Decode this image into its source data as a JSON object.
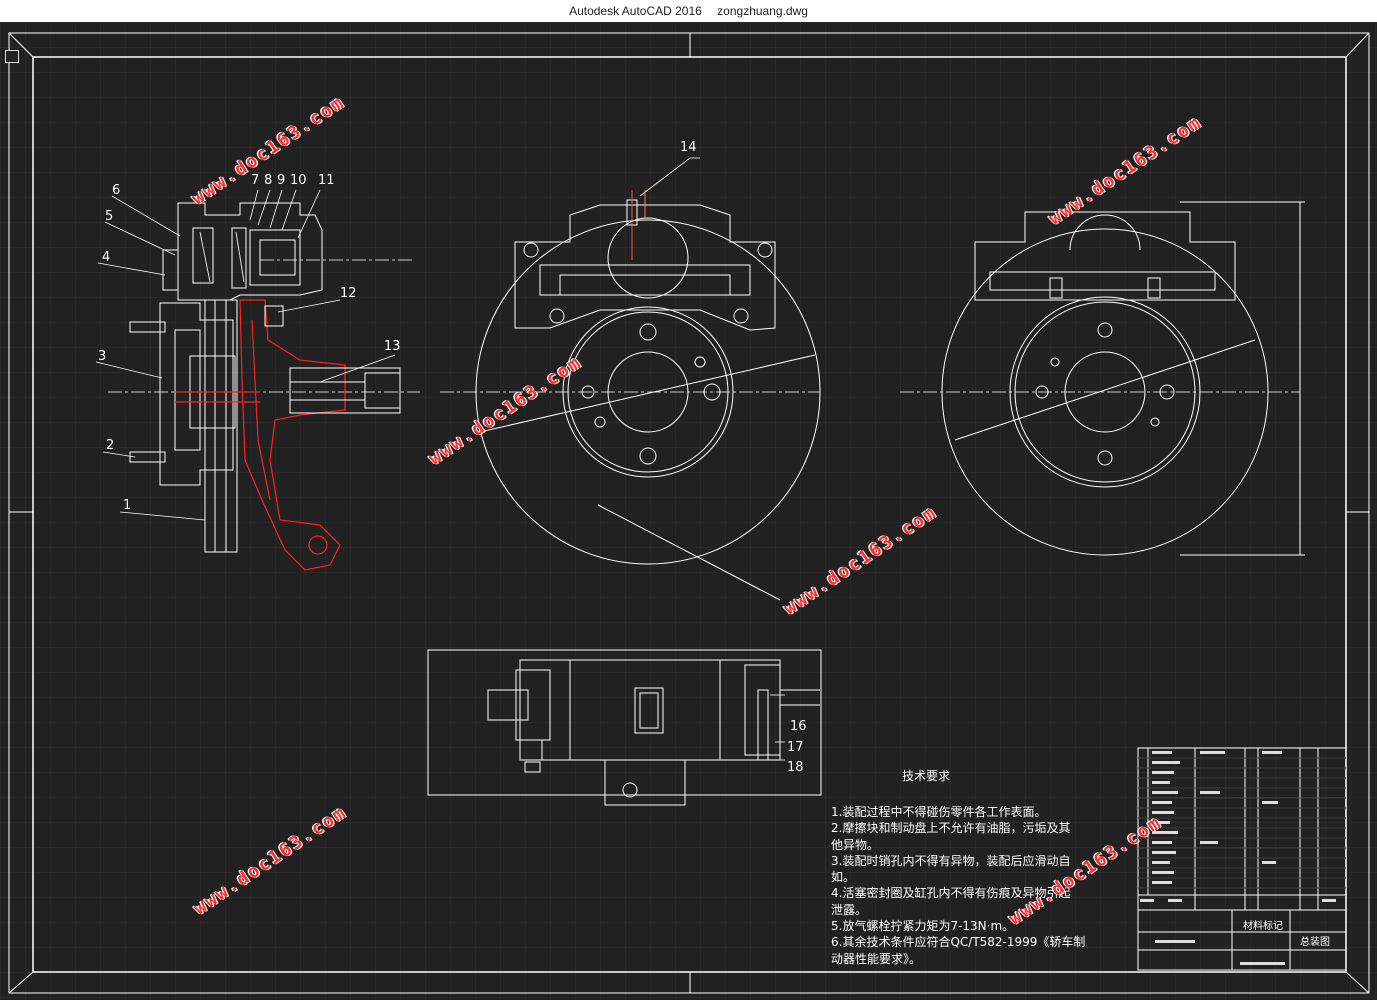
{
  "window": {
    "app_name": "Autodesk AutoCAD 2016",
    "file_name": "zongzhuang.dwg"
  },
  "callouts": [
    "1",
    "2",
    "3",
    "4",
    "5",
    "6",
    "7",
    "8",
    "9",
    "10",
    "11",
    "12",
    "13",
    "14",
    "16",
    "17",
    "18"
  ],
  "tech_requirements": {
    "title": "技术要求",
    "items": [
      "1.装配过程中不得碰伤零件各工作表面。",
      "2.摩擦块和制动盘上不允许有油脂，污垢及其",
      "他异物。",
      "3.装配时销孔内不得有异物，装配后应滑动自",
      "如。",
      "4.活塞密封圈及缸孔内不得有伤痕及异物引起",
      "泄露。",
      "5.放气螺栓拧紧力矩为7-13N·m。",
      "6.其余技术条件应符合QC/T582-1999《轿车制",
      "动器性能要求》。"
    ]
  },
  "title_block": {
    "material_mark": "材料标记",
    "drawing_name": "总装图"
  },
  "watermark": "www.doc163.com",
  "colors": {
    "background": "#212121",
    "lines": "#ffffff",
    "highlight": "#ff2020",
    "watermark": "#ff2b2b"
  }
}
